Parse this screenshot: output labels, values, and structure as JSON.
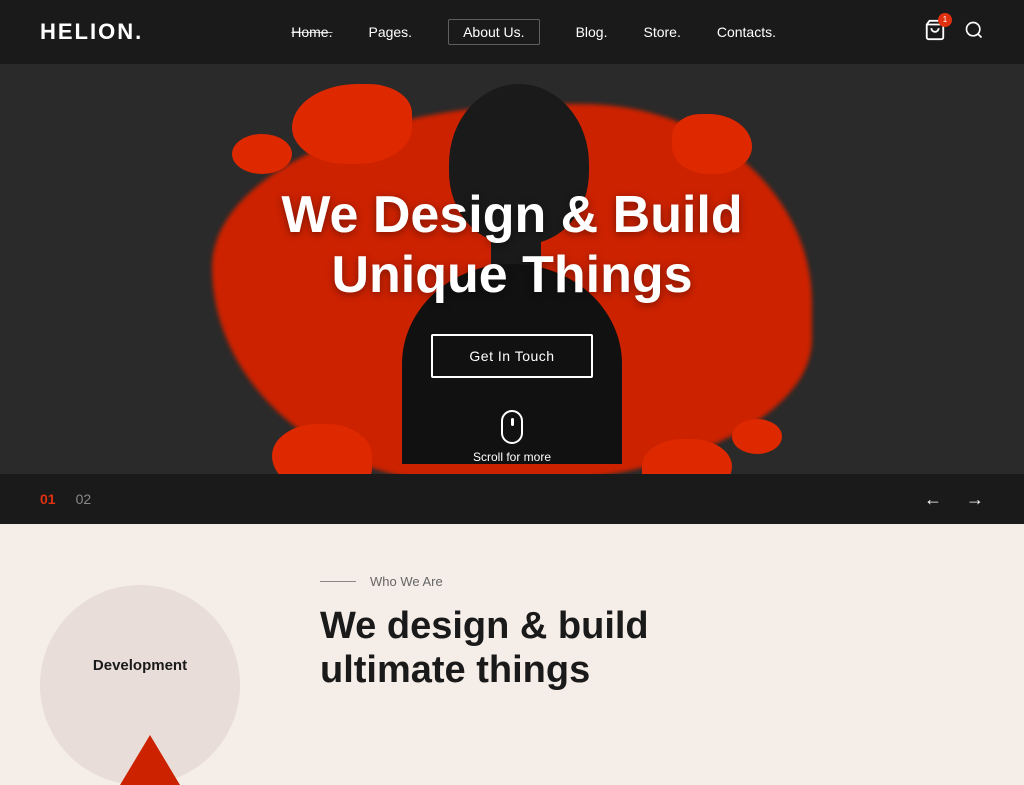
{
  "header": {
    "logo": "HELION.",
    "logo_dot": ".",
    "nav": [
      {
        "label": "Home.",
        "active": true
      },
      {
        "label": "Pages."
      },
      {
        "label": "About Us."
      },
      {
        "label": "Blog."
      },
      {
        "label": "Store."
      },
      {
        "label": "Contacts."
      }
    ],
    "cart_icon": "🛍",
    "cart_count": "1",
    "search_icon": "search"
  },
  "hero": {
    "title_line1": "We Design & Build",
    "title_line2": "Unique Things",
    "cta_label": "Get In Touch",
    "scroll_label": "Scroll for more",
    "slide_active": "01",
    "slide_inactive": "02"
  },
  "bottom": {
    "dev_label": "Development",
    "who_line": "Who We Are",
    "who_title_line1": "We design & build",
    "who_title_line2": "ultimate things"
  }
}
